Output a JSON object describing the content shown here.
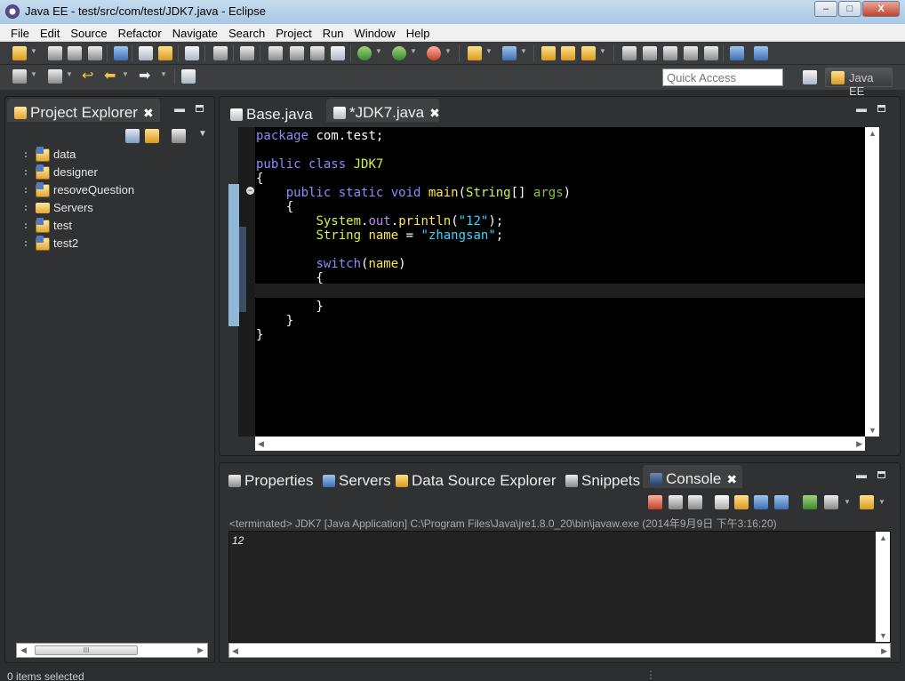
{
  "window": {
    "title": "Java EE - test/src/com/test/JDK7.java - Eclipse",
    "controls": [
      "–",
      "□",
      "X"
    ]
  },
  "menu": [
    "File",
    "Edit",
    "Source",
    "Refactor",
    "Navigate",
    "Search",
    "Project",
    "Run",
    "Window",
    "Help"
  ],
  "toolbar": {
    "quick_access_placeholder": "Quick Access",
    "perspective": "Java EE"
  },
  "project_explorer": {
    "tab_label": "Project Explorer",
    "items": [
      {
        "label": "data",
        "icon": "project-icon"
      },
      {
        "label": "designer",
        "icon": "project-icon"
      },
      {
        "label": "resoveQuestion",
        "icon": "project-icon"
      },
      {
        "label": "Servers",
        "icon": "folder-icon"
      },
      {
        "label": "test",
        "icon": "project-icon"
      },
      {
        "label": "test2",
        "icon": "project-icon"
      }
    ],
    "hscroll_grip": "III"
  },
  "editor": {
    "tabs": [
      {
        "label": "Base.java",
        "active": false
      },
      {
        "label": "*JDK7.java",
        "active": true
      }
    ]
  },
  "bottom_panel": {
    "tabs": [
      {
        "label": "Properties"
      },
      {
        "label": "Servers"
      },
      {
        "label": "Data Source Explorer"
      },
      {
        "label": "Snippets"
      },
      {
        "label": "Console",
        "active": true
      }
    ],
    "console_description": "<terminated> JDK7 [Java Application] C:\\Program Files\\Java\\jre1.8.0_20\\bin\\javaw.exe (2014年9月9日 下午3:16:20)",
    "console_output": "12"
  },
  "status": {
    "text": "0 items selected"
  },
  "colors": {
    "background": "#2b2d2f",
    "editor_bg": "#000000",
    "keyword": "#8a8eff",
    "class_name": "#d8f23a",
    "method": "#ffe64d",
    "string": "#3fd3ff"
  }
}
